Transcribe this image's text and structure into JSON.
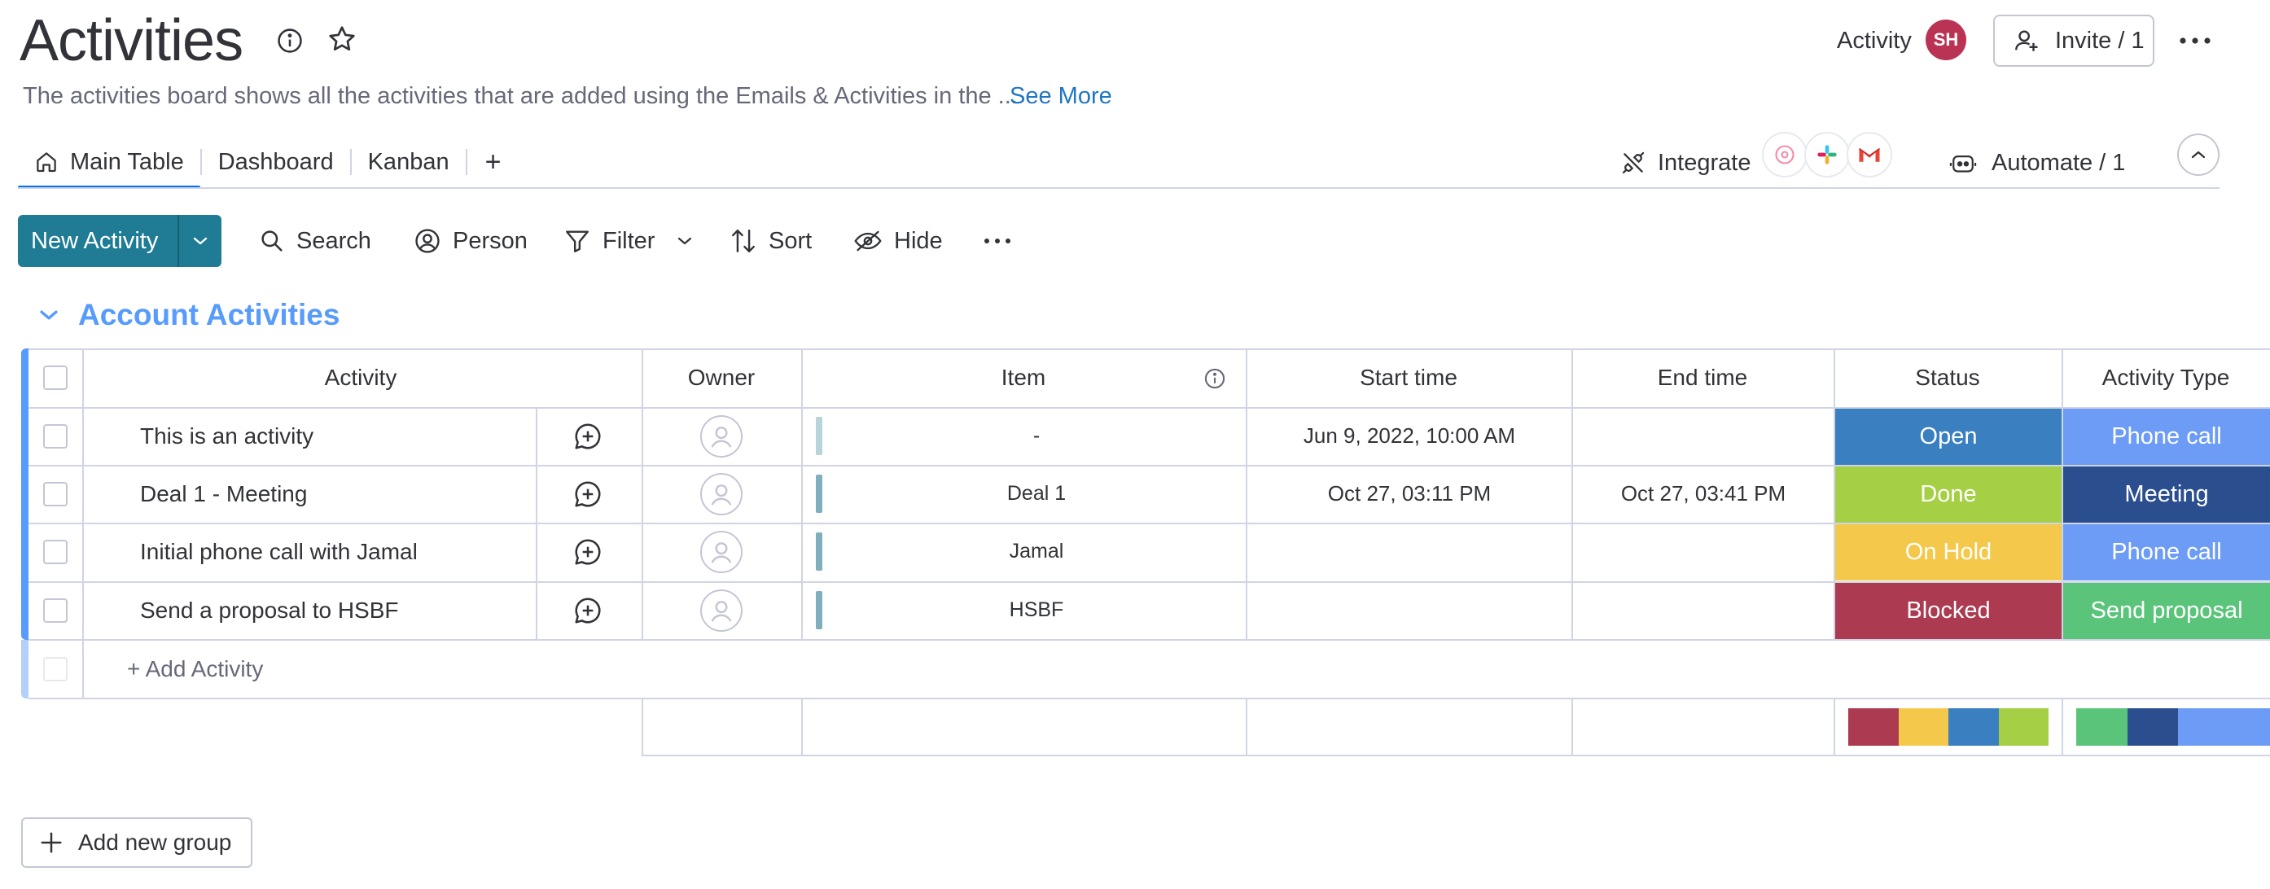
{
  "header": {
    "title": "Activities",
    "description": "The activities board shows all the activities that are added using the Emails & Activities in the ...",
    "see_more": "See More",
    "activity_label": "Activity",
    "user_initials": "SH",
    "invite_label": "Invite / 1"
  },
  "tabs": [
    {
      "label": "Main Table",
      "active": true
    },
    {
      "label": "Dashboard",
      "active": false
    },
    {
      "label": "Kanban",
      "active": false
    }
  ],
  "tabs_add": "+",
  "integrate_label": "Integrate",
  "automate_label": "Automate / 1",
  "toolbar": {
    "new_label": "New Activity",
    "search": "Search",
    "person": "Person",
    "filter": "Filter",
    "sort": "Sort",
    "hide": "Hide"
  },
  "group": {
    "title": "Account Activities",
    "color": "#579bfc"
  },
  "columns": {
    "activity": "Activity",
    "owner": "Owner",
    "item": "Item",
    "start": "Start time",
    "end": "End time",
    "status": "Status",
    "type": "Activity Type"
  },
  "rows": [
    {
      "name": "This is an activity",
      "item": "-",
      "start": "Jun 9, 2022, 10:00 AM",
      "end": "",
      "status": "Open",
      "status_color": "#3a80c1",
      "type": "Phone call",
      "type_color": "#6c9cf5"
    },
    {
      "name": "Deal 1 - Meeting",
      "item": "Deal 1",
      "start": "Oct 27, 03:11 PM",
      "end": "Oct 27, 03:41 PM",
      "status": "Done",
      "status_color": "#a5cf45",
      "type": "Meeting",
      "type_color": "#2b4f8e"
    },
    {
      "name": "Initial phone call with Jamal",
      "item": "Jamal",
      "start": "",
      "end": "",
      "status": "On Hold",
      "status_color": "#f4c84a",
      "type": "Phone call",
      "type_color": "#6c9cf5"
    },
    {
      "name": "Send a proposal to HSBF",
      "item": "HSBF",
      "start": "",
      "end": "",
      "status": "Blocked",
      "status_color": "#ac3a50",
      "type": "Send proposal",
      "type_color": "#5ac57a"
    }
  ],
  "add_row_label": "+ Add Activity",
  "summary": {
    "status_colors": [
      "#ac3a50",
      "#f4c84a",
      "#3a80c1",
      "#a5cf45"
    ],
    "type_colors": [
      "#5ac57a",
      "#2b4f8e",
      "#6c9cf5"
    ]
  },
  "add_group_label": "Add new group"
}
